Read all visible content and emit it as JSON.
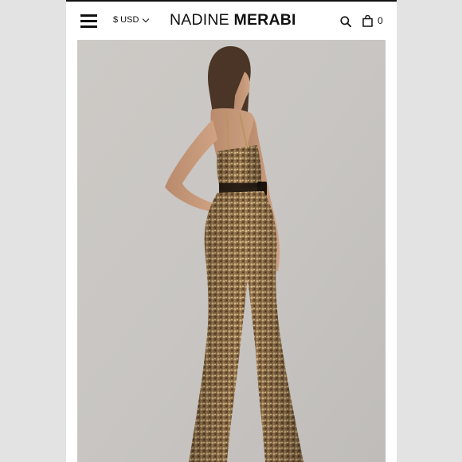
{
  "header": {
    "currency": "$ USD",
    "logo_light": "NADINE",
    "logo_bold": "MERABI",
    "cart_count": "0"
  },
  "icons": {
    "menu": "menu-icon",
    "currency_chevron": "chevron-down-icon",
    "search": "search-icon",
    "cart": "bag-icon"
  },
  "colors": {
    "text": "#111111",
    "background": "#ffffff",
    "photo_backdrop": "#c9c6c3",
    "sequin_gold": "#a8865a"
  }
}
